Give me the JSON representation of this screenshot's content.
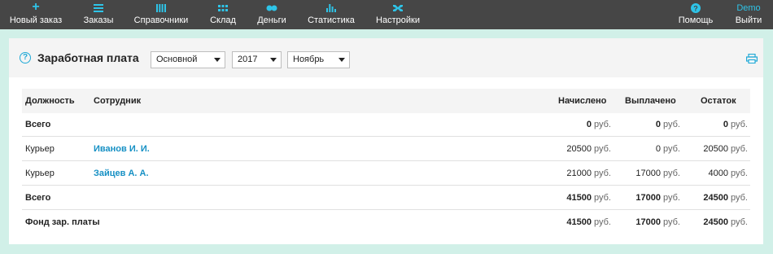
{
  "nav": {
    "items": [
      {
        "label": "Новый заказ",
        "icon": "plus-icon"
      },
      {
        "label": "Заказы",
        "icon": "list-icon"
      },
      {
        "label": "Справочники",
        "icon": "columns-icon"
      },
      {
        "label": "Склад",
        "icon": "grid-icon"
      },
      {
        "label": "Деньги",
        "icon": "coins-icon"
      },
      {
        "label": "Статистика",
        "icon": "bar-chart-icon"
      },
      {
        "label": "Настройки",
        "icon": "wrench-icon"
      }
    ],
    "help_label": "Помощь",
    "user_label": "Demo",
    "logout_label": "Выйти"
  },
  "page": {
    "title": "Заработная плата",
    "filters": {
      "type": "Основной",
      "year": "2017",
      "month": "Ноябрь"
    }
  },
  "table": {
    "headers": {
      "position": "Должность",
      "employee": "Сотрудник",
      "accrued": "Начислено",
      "paid": "Выплачено",
      "balance": "Остаток"
    },
    "currency": "руб.",
    "rows": [
      {
        "position": "Всего",
        "employee": "",
        "accrued": "0",
        "paid": "0",
        "balance": "0"
      },
      {
        "position": "Курьер",
        "employee": "Иванов И. И.",
        "accrued": "20500",
        "paid": "0",
        "balance": "20500"
      },
      {
        "position": "Курьер",
        "employee": "Зайцев А. А.",
        "accrued": "21000",
        "paid": "17000",
        "balance": "4000"
      },
      {
        "position": "Всего",
        "employee": "",
        "accrued": "41500",
        "paid": "17000",
        "balance": "24500"
      },
      {
        "position": "Фонд зар. платы",
        "employee": "",
        "accrued": "41500",
        "paid": "17000",
        "balance": "24500"
      }
    ]
  },
  "colors": {
    "accent": "#2ec4e8",
    "topbar": "#464646",
    "link": "#1690c4",
    "background": "#d1f0e8"
  }
}
